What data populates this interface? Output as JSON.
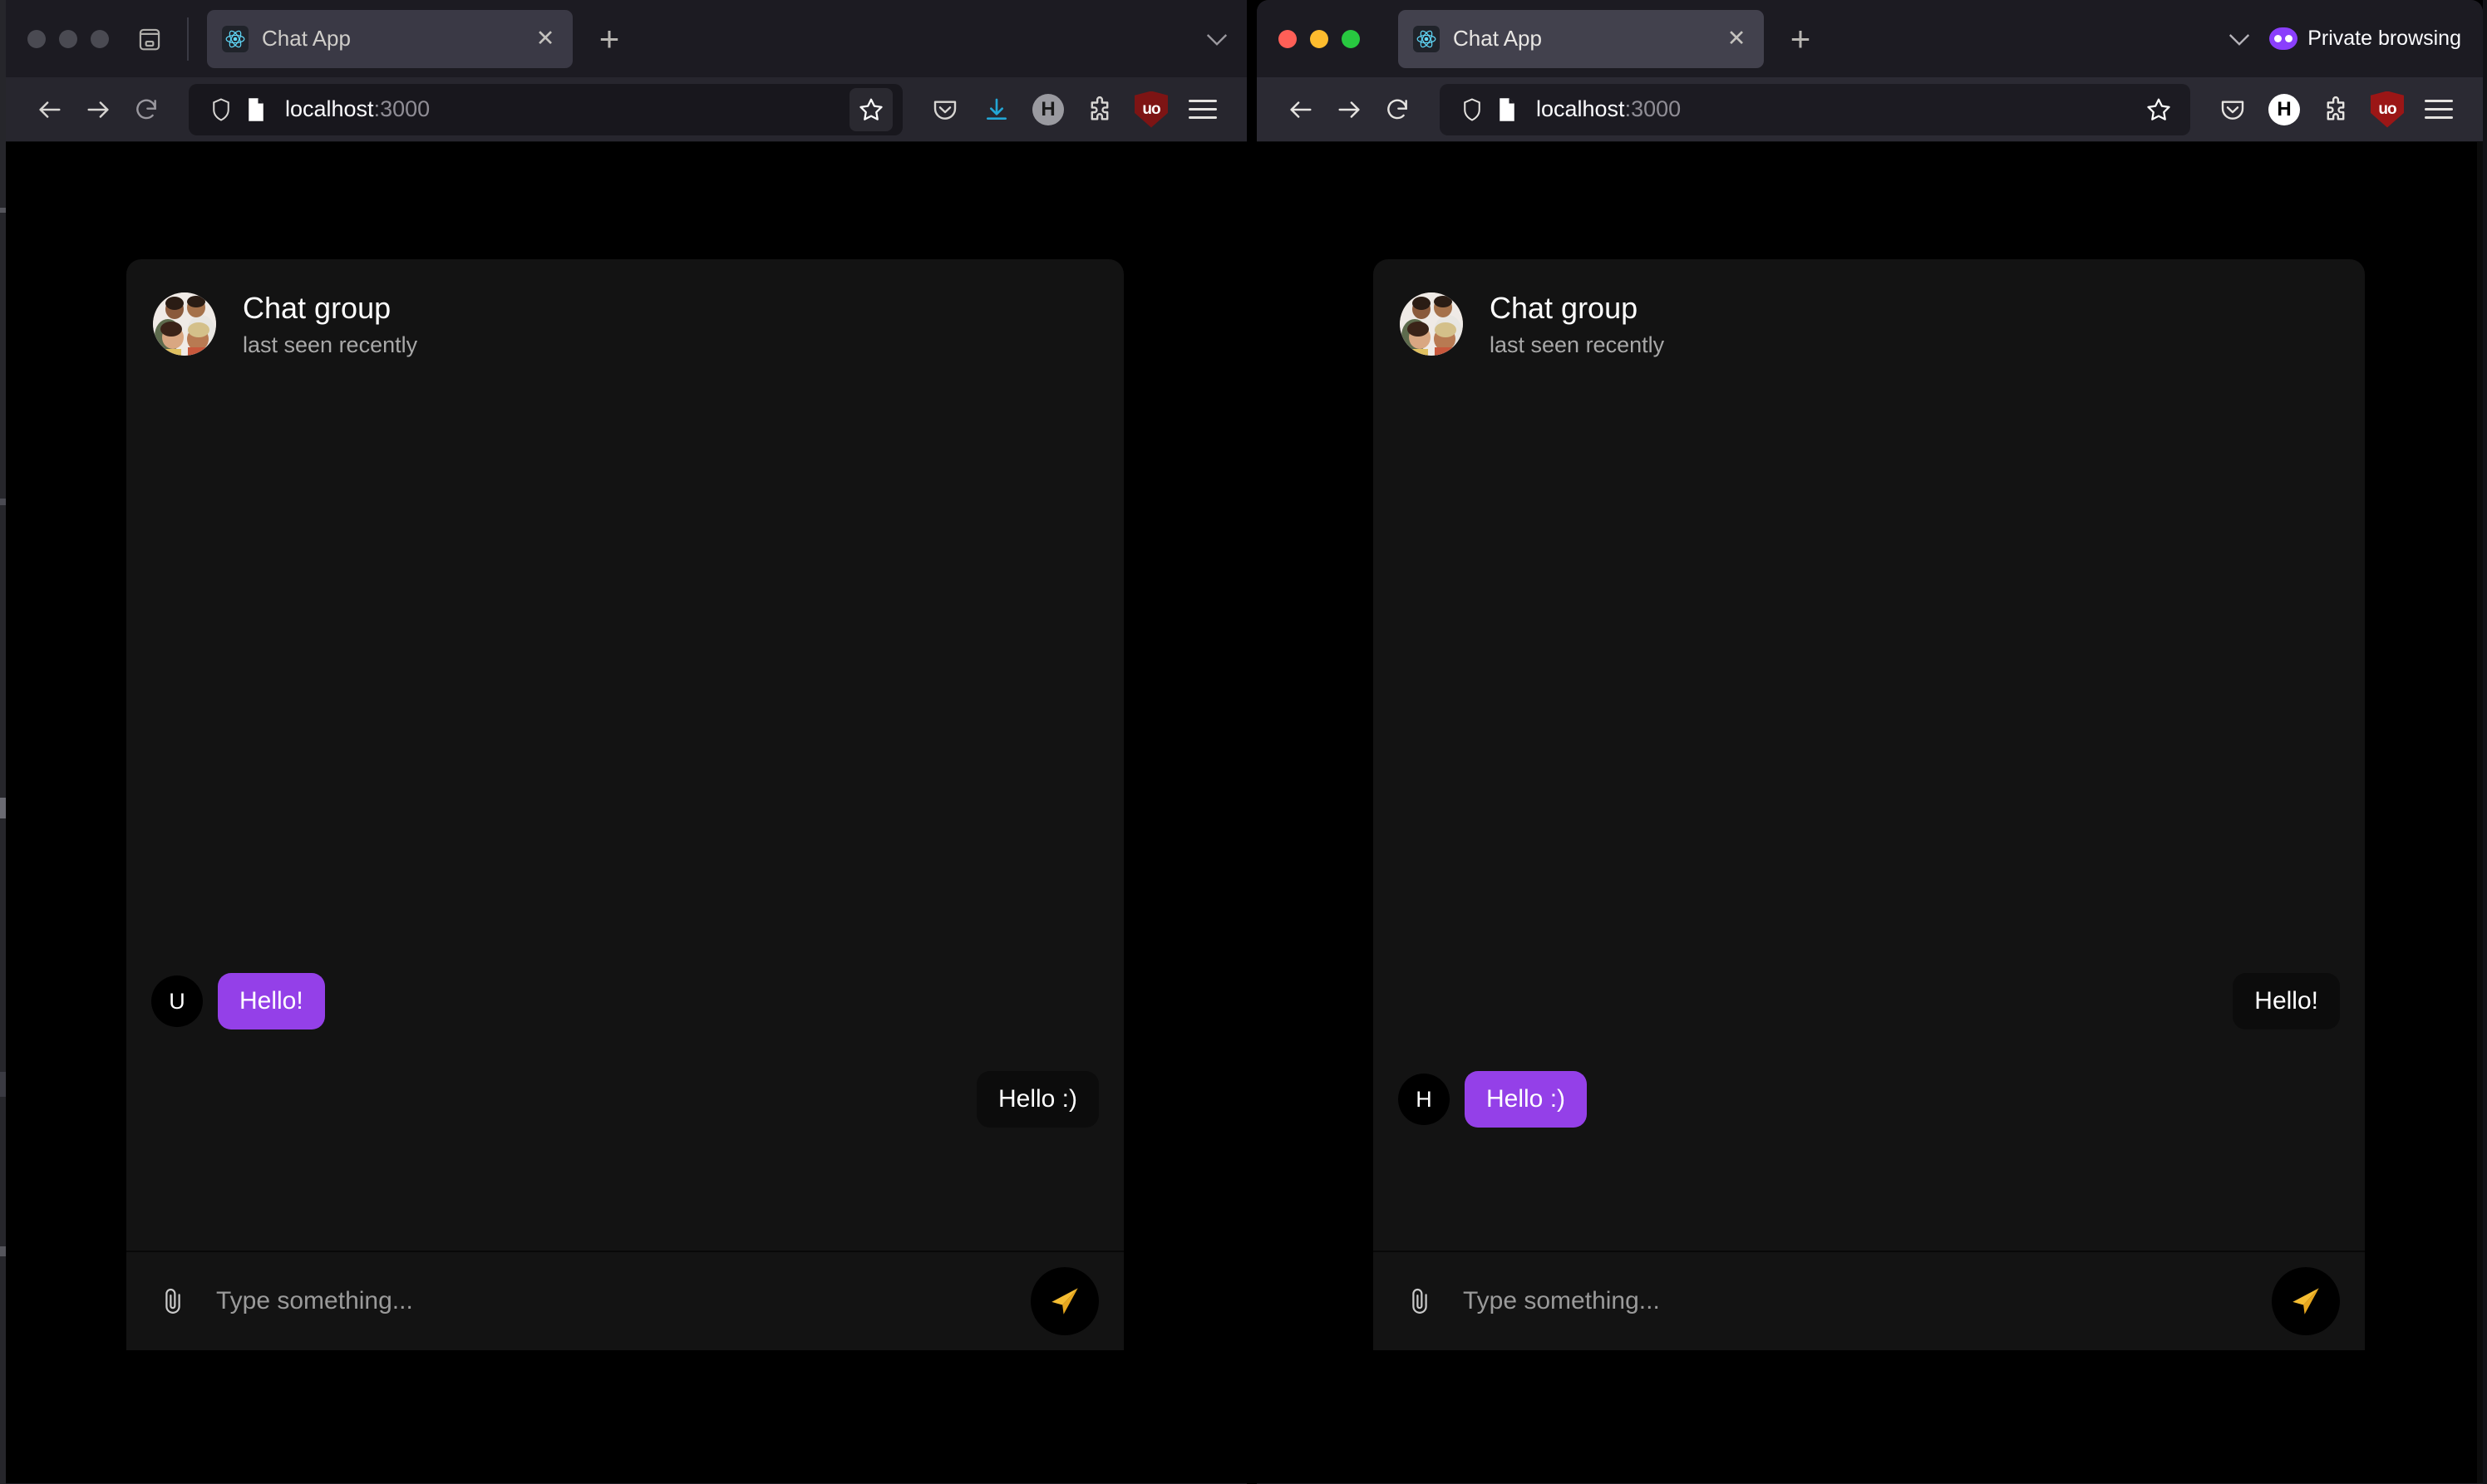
{
  "windows": [
    {
      "id": "left",
      "active": false,
      "private_browsing": false,
      "traffic_lights": [
        "inactive",
        "inactive",
        "inactive"
      ],
      "toolbar_has_download": true,
      "tab": {
        "title": "Chat App",
        "favicon": "react-atom-icon",
        "close_label": "✕"
      },
      "newtab_label": "+",
      "url": {
        "host": "localhost",
        "port": ":3000"
      },
      "page": {
        "header": {
          "title": "Chat group",
          "status": "last seen recently",
          "avatar": "group-photo-avatar"
        },
        "messages": [
          {
            "id": "m1",
            "side": "in",
            "text": "Hello!",
            "bubble": "purple",
            "avatar": "U"
          },
          {
            "id": "m2",
            "side": "out",
            "text": "Hello :)",
            "bubble": "dark",
            "avatar": ""
          }
        ],
        "composer": {
          "placeholder": "Type something...",
          "attach_icon": "paperclip-icon",
          "send_icon": "send-paper-plane-icon"
        }
      }
    },
    {
      "id": "right",
      "active": true,
      "private_browsing": true,
      "private_label": "Private browsing",
      "traffic_lights": [
        "red",
        "yellow",
        "green"
      ],
      "toolbar_has_download": false,
      "tab": {
        "title": "Chat App",
        "favicon": "react-atom-icon",
        "close_label": "✕"
      },
      "newtab_label": "+",
      "url": {
        "host": "localhost",
        "port": ":3000"
      },
      "page": {
        "header": {
          "title": "Chat group",
          "status": "last seen recently",
          "avatar": "group-photo-avatar"
        },
        "messages": [
          {
            "id": "m1",
            "side": "out",
            "text": "Hello!",
            "bubble": "dark",
            "avatar": ""
          },
          {
            "id": "m2",
            "side": "in",
            "text": "Hello :)",
            "bubble": "purple",
            "avatar": "H"
          }
        ],
        "composer": {
          "placeholder": "Type something...",
          "attach_icon": "paperclip-icon",
          "send_icon": "send-paper-plane-icon"
        }
      }
    }
  ],
  "colors": {
    "page_background": "#000000",
    "card_background": "#131313",
    "bubble_purple": "#9440e8",
    "bubble_dark": "#0c0c0c",
    "send_accent": "#f5bd32",
    "chrome_toolbar": "#2b2a33",
    "chrome_tabstrip": "#1c1b22",
    "private_badge": "#8a3ffc",
    "ublock_red": "#9b1616",
    "download_accent": "#23a6d5"
  }
}
